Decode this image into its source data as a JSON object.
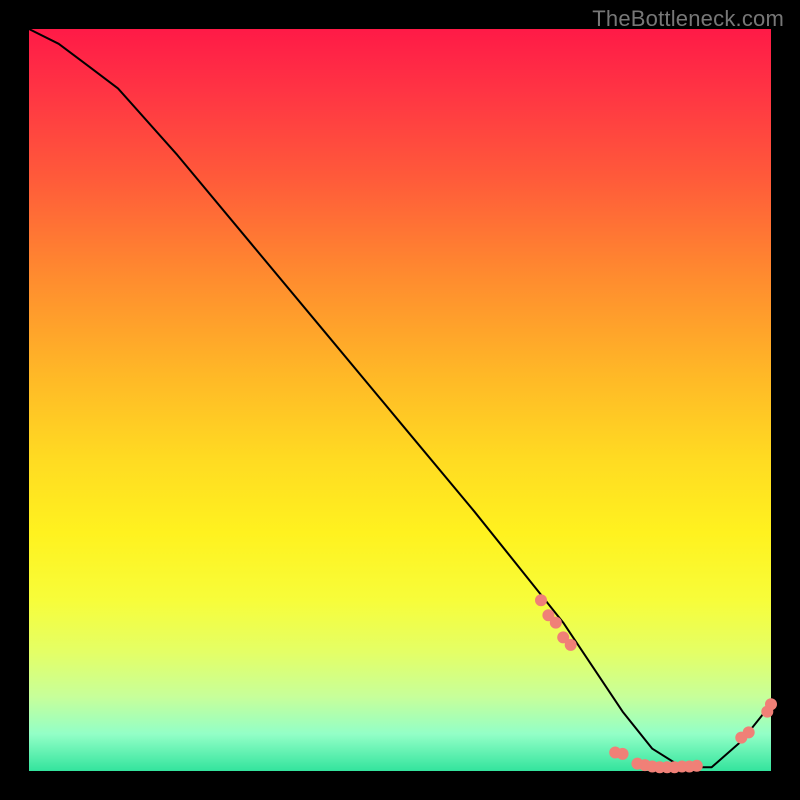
{
  "attribution": "TheBottleneck.com",
  "chart_data": {
    "type": "line",
    "title": "",
    "xlabel": "",
    "ylabel": "",
    "xlim": [
      0,
      100
    ],
    "ylim": [
      0,
      100
    ],
    "series": [
      {
        "name": "bottleneck-curve",
        "x": [
          0,
          4,
          8,
          12,
          20,
          30,
          40,
          50,
          60,
          68,
          72,
          76,
          80,
          84,
          88,
          92,
          96,
          100
        ],
        "y": [
          100,
          98,
          95,
          92,
          83,
          71,
          59,
          47,
          35,
          25,
          20,
          14,
          8,
          3,
          0.5,
          0.5,
          4,
          9
        ]
      }
    ],
    "markers": [
      {
        "name": "cluster-left",
        "x": 69,
        "y": 23
      },
      {
        "name": "cluster-left",
        "x": 70,
        "y": 21
      },
      {
        "name": "cluster-left",
        "x": 71,
        "y": 20
      },
      {
        "name": "cluster-left",
        "x": 72,
        "y": 18
      },
      {
        "name": "cluster-left",
        "x": 73,
        "y": 17
      },
      {
        "name": "bottom-a",
        "x": 79,
        "y": 2.5
      },
      {
        "name": "bottom-a",
        "x": 80,
        "y": 2.3
      },
      {
        "name": "bottom-b",
        "x": 82,
        "y": 1.0
      },
      {
        "name": "bottom-b",
        "x": 83,
        "y": 0.8
      },
      {
        "name": "bottom-b",
        "x": 84,
        "y": 0.6
      },
      {
        "name": "bottom-b",
        "x": 85,
        "y": 0.5
      },
      {
        "name": "bottom-b",
        "x": 86,
        "y": 0.5
      },
      {
        "name": "bottom-b",
        "x": 87,
        "y": 0.5
      },
      {
        "name": "bottom-b",
        "x": 88,
        "y": 0.6
      },
      {
        "name": "bottom-b",
        "x": 89,
        "y": 0.6
      },
      {
        "name": "bottom-b",
        "x": 90,
        "y": 0.7
      },
      {
        "name": "right-rise",
        "x": 96,
        "y": 4.5
      },
      {
        "name": "right-rise",
        "x": 97,
        "y": 5.2
      },
      {
        "name": "right-rise",
        "x": 99.5,
        "y": 8.0
      },
      {
        "name": "right-rise",
        "x": 100,
        "y": 9.0
      }
    ],
    "marker_color": "#f08077",
    "line_color": "#000000"
  }
}
